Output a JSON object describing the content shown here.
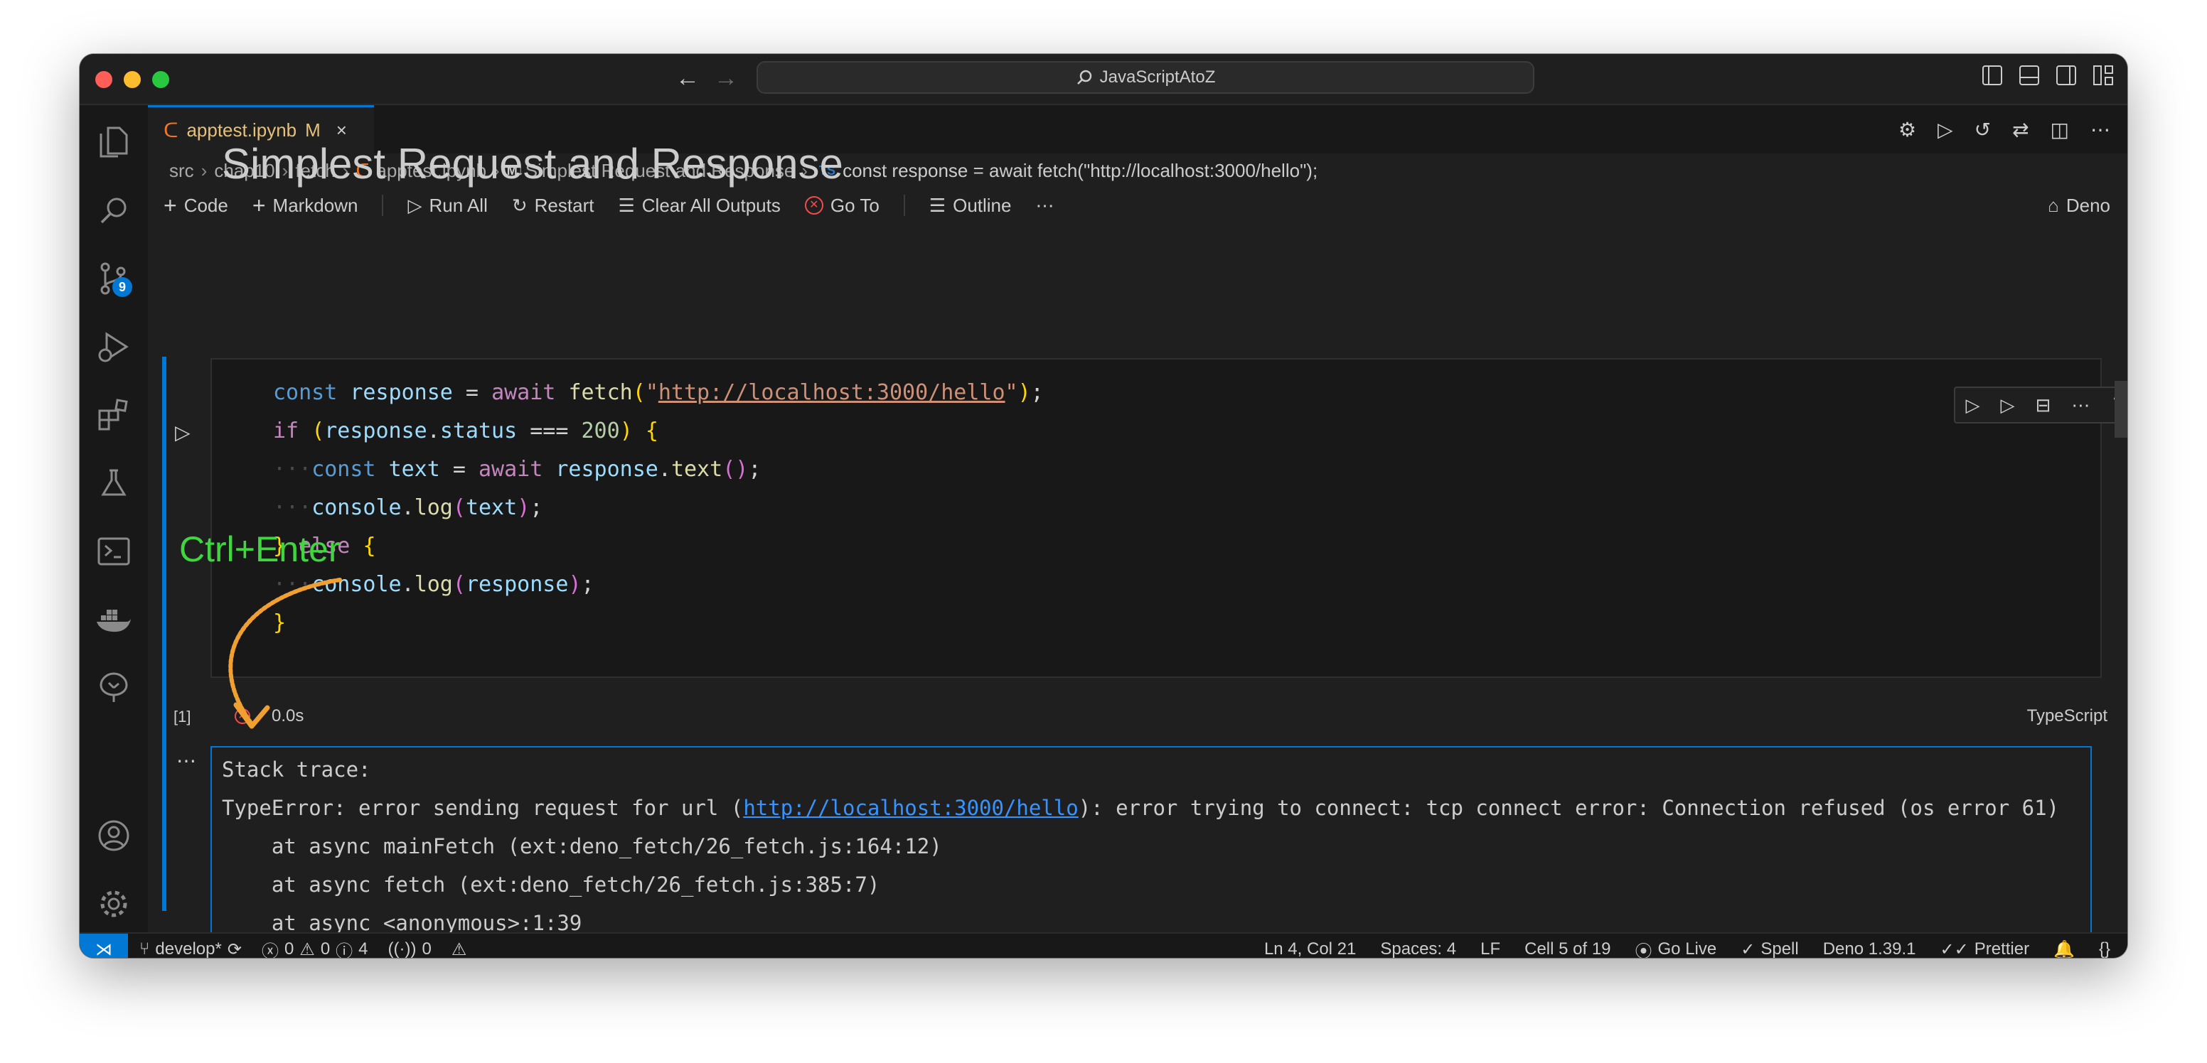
{
  "window": {
    "search_text": "JavaScriptAtoZ"
  },
  "tab": {
    "name": "apptest.ipynb",
    "modified": "M",
    "close": "×"
  },
  "breadcrumb": {
    "items": [
      "src",
      "chap10",
      "fetch",
      "apptest.ipynb",
      "Simplest Request and Response",
      "const response = await fetch(\"http://localhost:3000/hello\");"
    ],
    "ts_badge": "TS",
    "md_badge": "M↓"
  },
  "toolbar": {
    "code": "Code",
    "markdown": "Markdown",
    "run_all": "Run All",
    "restart": "Restart",
    "clear_outputs": "Clear All Outputs",
    "go_to": "Go To",
    "outline": "Outline",
    "more": "⋯",
    "kernel": "Deno"
  },
  "activity": {
    "source_control_badge": "9"
  },
  "notebook": {
    "heading": "Simplest Request and Response",
    "exec_count": "[1]",
    "duration": "0.0s",
    "language": "TypeScript",
    "output_lines": [
      "Stack trace:",
      "    at async mainFetch (ext:deno_fetch/26_fetch.js:164:12)",
      "    at async fetch (ext:deno_fetch/26_fetch.js:385:7)",
      "    at async <anonymous>:1:39"
    ],
    "error_prefix": "TypeError: error sending request for url (",
    "error_url": "http://localhost:3000/hello",
    "error_suffix": "): error trying to connect: tcp connect error: Connection refused (os error 61)"
  },
  "annotation": {
    "label": "Ctrl+Enter",
    "color": "#3fd63f",
    "arrow_color": "#f0a030"
  },
  "statusbar": {
    "branch": "develop*",
    "errors": "0",
    "warnings": "0",
    "infos": "4",
    "ports": "0",
    "position": "Ln 4, Col 21",
    "spaces": "Spaces: 4",
    "eol": "LF",
    "cell": "Cell 5 of 19",
    "go_live": "Go Live",
    "spell": "Spell",
    "deno": "Deno 1.39.1",
    "prettier": "Prettier"
  },
  "colors": {
    "accent": "#0078d4",
    "background": "#1f1f1f",
    "error": "#f14c4c"
  }
}
